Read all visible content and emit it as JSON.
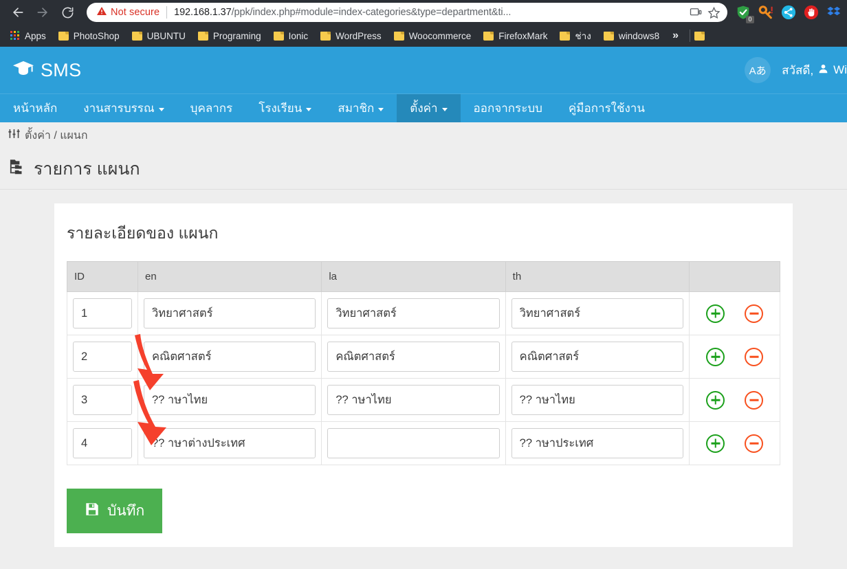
{
  "browser": {
    "nav": {
      "back_icon": "arrow-left-icon",
      "forward_icon": "arrow-right-icon",
      "reload_icon": "reload-icon"
    },
    "omnibox": {
      "security_label": "Not secure",
      "security_icon": "warning-triangle-icon",
      "url_host": "192.168.1.37",
      "url_path": "/ppk/index.php#module=index-categories&type=department&ti...",
      "cast_icon": "cast-icon",
      "bookmark_icon": "star-icon"
    },
    "extensions": [
      {
        "name": "shield-extension-icon",
        "badge": "0",
        "color": "#2f9e44"
      },
      {
        "name": "key-extension-icon",
        "color": "#f08c1f"
      },
      {
        "name": "share-nodes-extension-icon",
        "color": "#22b8e6"
      },
      {
        "name": "stop-hand-extension-icon",
        "color": "#e02020"
      },
      {
        "name": "dropbox-extension-icon",
        "color": "#2e7fe8"
      }
    ],
    "bookmarks": {
      "apps_label": "Apps",
      "items": [
        {
          "label": "PhotoShop"
        },
        {
          "label": "UBUNTU"
        },
        {
          "label": "Programing"
        },
        {
          "label": "Ionic"
        },
        {
          "label": "WordPress"
        },
        {
          "label": "Woocommerce"
        },
        {
          "label": "FirefoxMark"
        },
        {
          "label": "ช่าง"
        },
        {
          "label": "windows8"
        }
      ],
      "overflow_label": "»"
    }
  },
  "app": {
    "brand": {
      "name": "SMS",
      "logo_icon": "graduation-cap-icon",
      "accent_color": "#2d9fd9"
    },
    "header_right": {
      "lang_toggle_label": "Aあ",
      "greeting": "สวัสดี,",
      "user_icon": "user-icon",
      "username": "Wi"
    },
    "nav": [
      {
        "label": "หน้าหลัก",
        "has_caret": false,
        "active": false
      },
      {
        "label": "งานสารบรรณ",
        "has_caret": true,
        "active": false
      },
      {
        "label": "บุคลากร",
        "has_caret": false,
        "active": false
      },
      {
        "label": "โรงเรียน",
        "has_caret": true,
        "active": false
      },
      {
        "label": "สมาชิก",
        "has_caret": true,
        "active": false
      },
      {
        "label": "ตั้งค่า",
        "has_caret": true,
        "active": true
      },
      {
        "label": "ออกจากระบบ",
        "has_caret": false,
        "active": false
      },
      {
        "label": "คู่มือการใช้งาน",
        "has_caret": false,
        "active": false
      }
    ],
    "breadcrumb": {
      "icon": "sliders-icon",
      "text": "ตั้งค่า / แผนก"
    },
    "page_title": {
      "icon": "sitemap-folder-icon",
      "text": "รายการ แผนก"
    },
    "card": {
      "title": "รายละเอียดของ แผนก",
      "table": {
        "headers": [
          "ID",
          "en",
          "la",
          "th",
          ""
        ],
        "rows": [
          {
            "id": "1",
            "en": "วิทยาศาสตร์",
            "la": "วิทยาศาสตร์",
            "th": "วิทยาศาสตร์"
          },
          {
            "id": "2",
            "en": "คณิตศาสตร์",
            "la": "คณิตศาสตร์",
            "th": "คณิตศาสตร์"
          },
          {
            "id": "3",
            "en": "?? าษาไทย",
            "la": "?? าษาไทย",
            "th": "?? าษาไทย"
          },
          {
            "id": "4",
            "en": "?? าษาต่างประเทศ",
            "la": "",
            "th": "?? าษาประเทศ"
          }
        ],
        "row_actions": {
          "add_icon": "plus-circle-icon",
          "remove_icon": "minus-circle-icon",
          "add_color": "#1ba01b",
          "remove_color": "#f8501e"
        }
      },
      "save_button": {
        "label": "บันทึก",
        "icon": "floppy-save-icon",
        "color": "#4cb050"
      }
    },
    "annotations": {
      "arrow_color": "#f5402c",
      "arrow_count": 2
    }
  }
}
